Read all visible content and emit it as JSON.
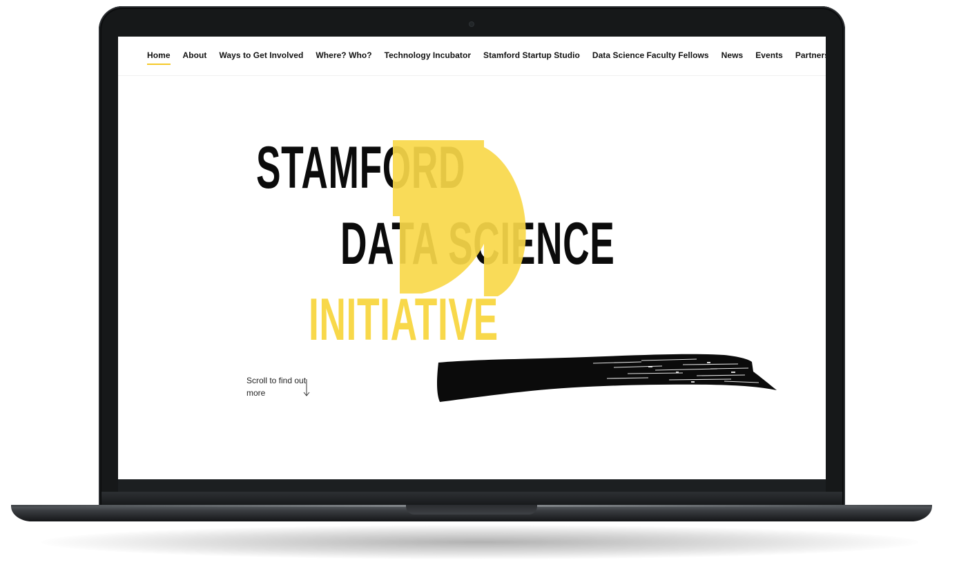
{
  "nav": {
    "items": [
      {
        "label": "Home",
        "active": true
      },
      {
        "label": "About",
        "active": false
      },
      {
        "label": "Ways to Get Involved",
        "active": false
      },
      {
        "label": "Where? Who?",
        "active": false
      },
      {
        "label": "Technology Incubator",
        "active": false
      },
      {
        "label": "Stamford Startup Studio",
        "active": false
      },
      {
        "label": "Data Science Faculty Fellows",
        "active": false
      },
      {
        "label": "News",
        "active": false
      },
      {
        "label": "Events",
        "active": false
      },
      {
        "label": "Partners",
        "active": false
      }
    ]
  },
  "hero": {
    "line1": "STAMFORD",
    "line2": "DATA SCIENCE",
    "line3": "INITIATIVE"
  },
  "scroll": {
    "text": "Scroll to find out more",
    "icon": "arrow-down-icon"
  },
  "colors": {
    "accent_yellow": "#f8d84a",
    "text_dark": "#0b0b0b",
    "laptop_frame": "#161819"
  }
}
